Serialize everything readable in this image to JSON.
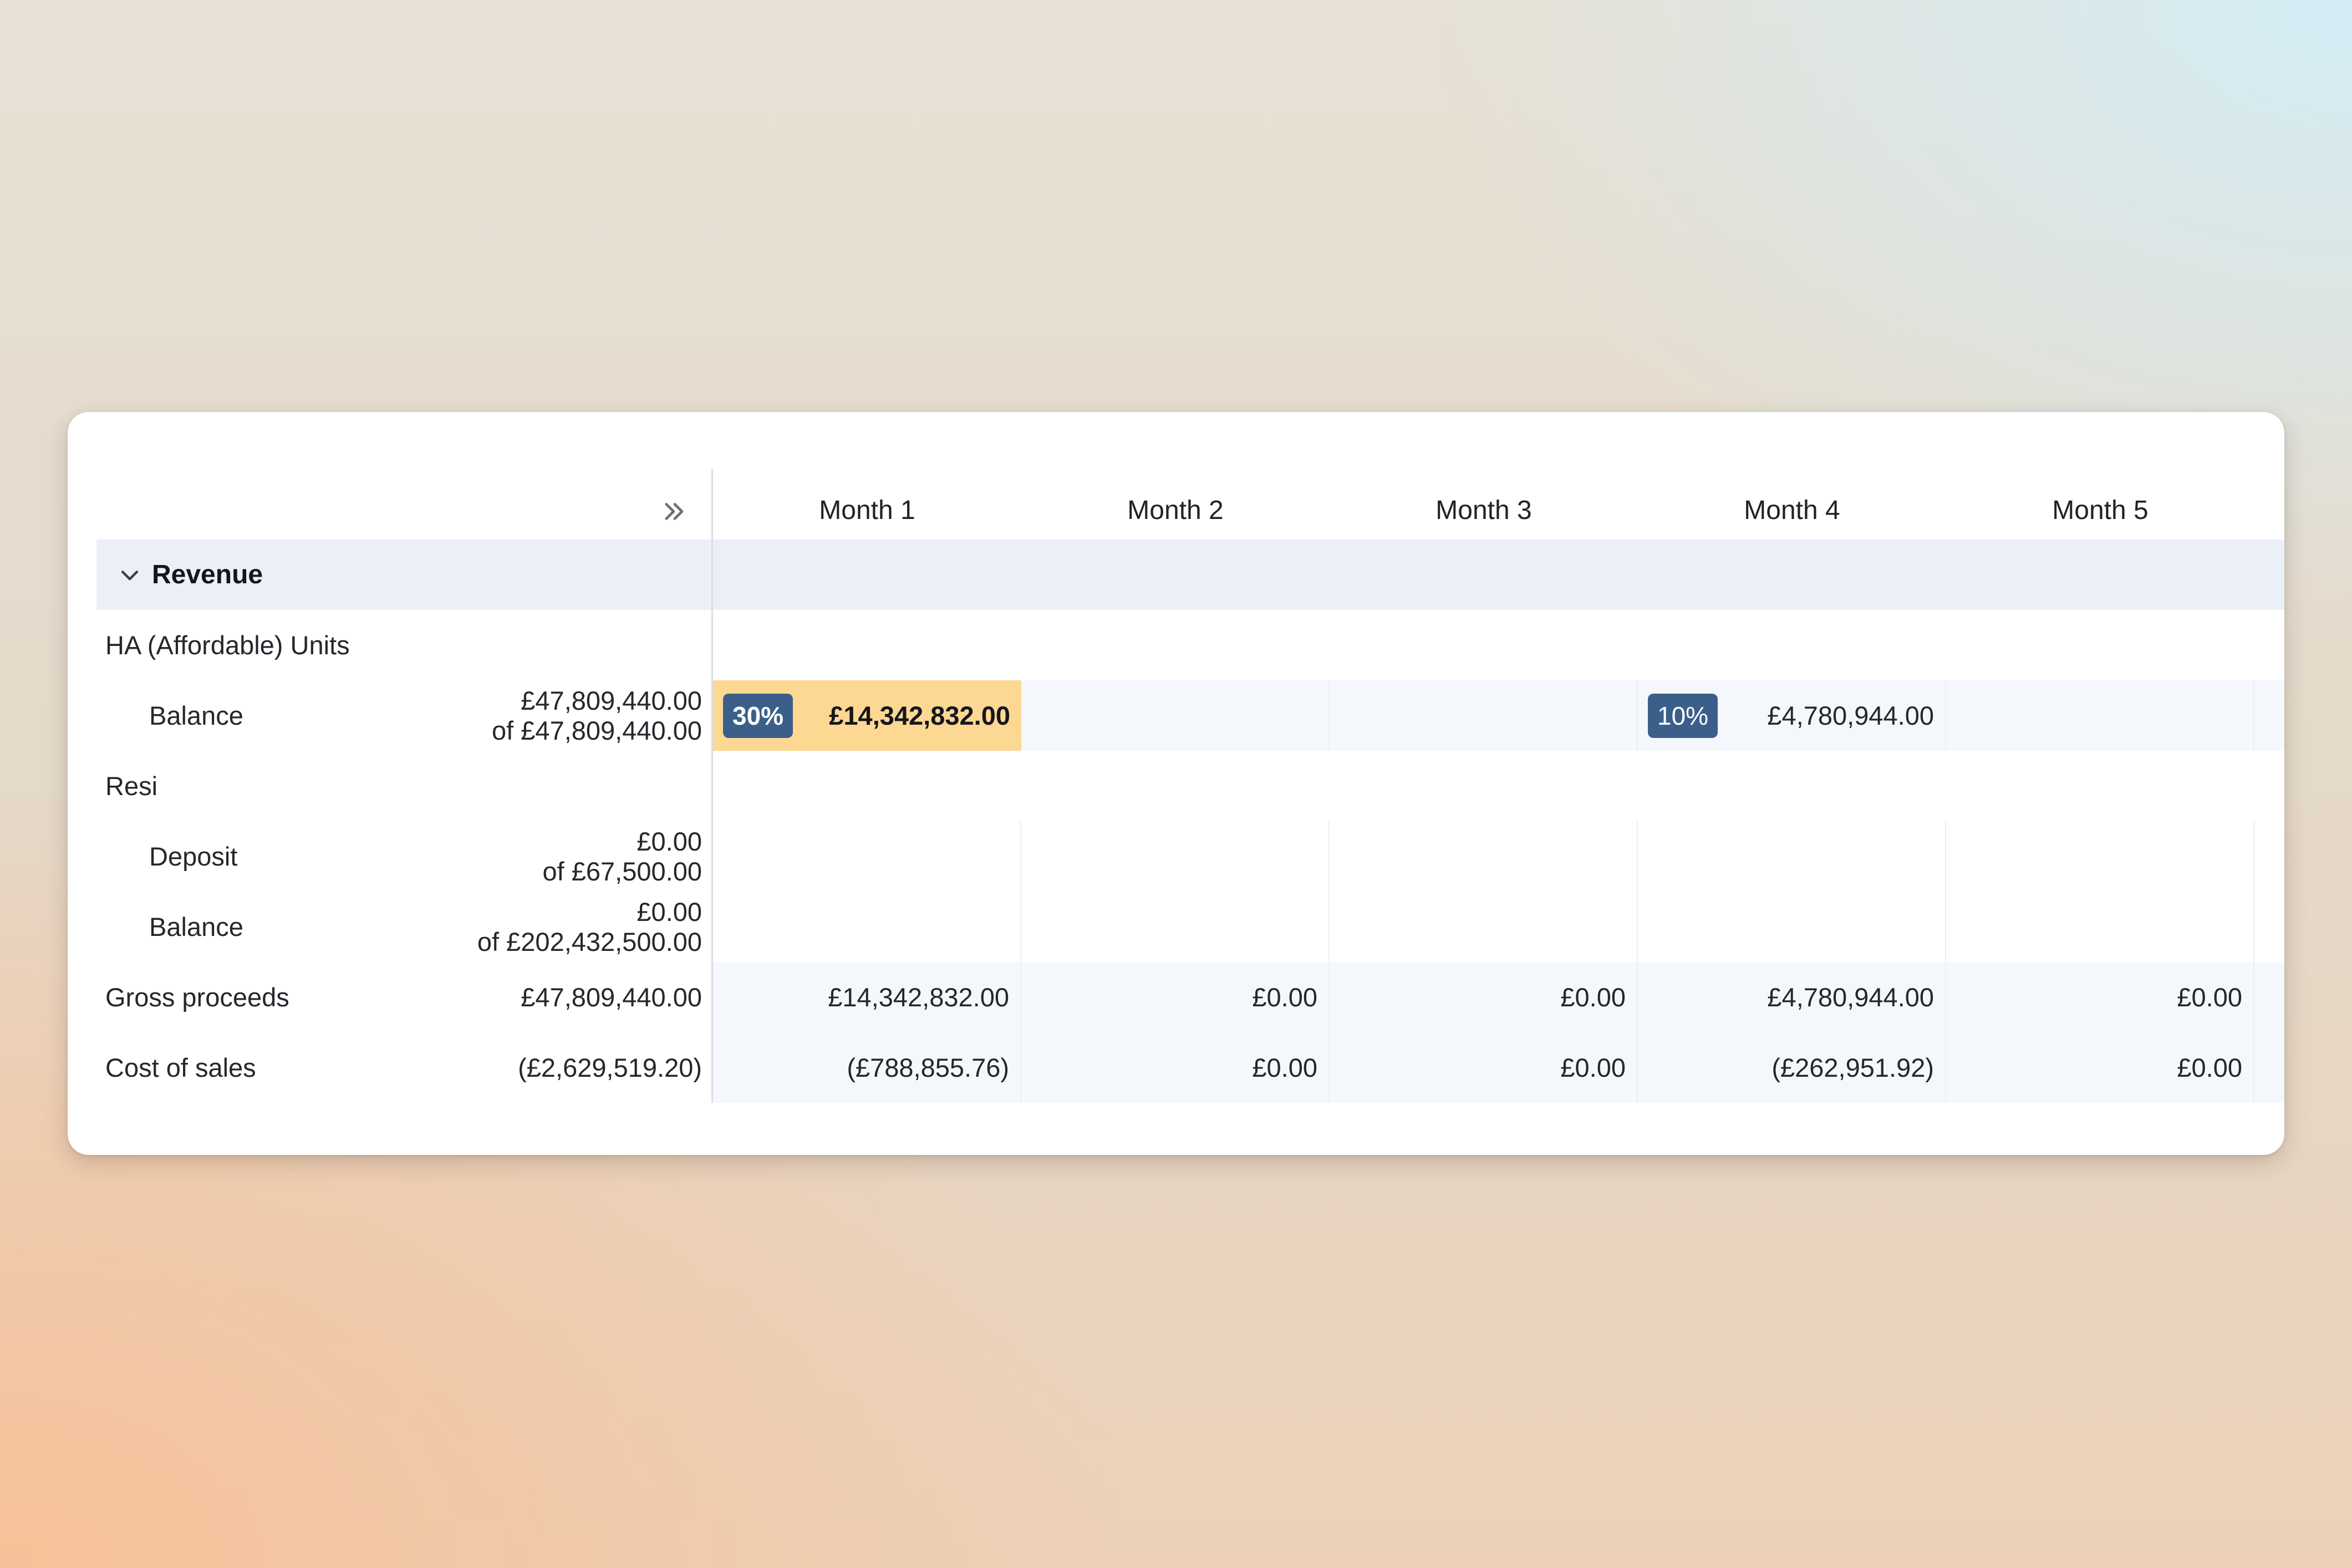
{
  "columns": [
    "Month 1",
    "Month 2",
    "Month 3",
    "Month 4",
    "Month 5"
  ],
  "icons": {
    "expand": "double-chevron-right-icon",
    "collapse": "chevron-down-icon"
  },
  "colors": {
    "section_bg": "#ebeff7",
    "highlight": "#fcd893",
    "pct_badge": "#3c5f8a",
    "row_tint": "#f4f8fc"
  },
  "section": {
    "title": "Revenue"
  },
  "ha_group": {
    "label": "HA (Affordable) Units",
    "balance": {
      "label": "Balance",
      "allocated": "£47,809,440.00",
      "of_total": "of £47,809,440.00",
      "month1": {
        "pct": "30%",
        "value": "£14,342,832.00"
      },
      "month4": {
        "pct": "10%",
        "value": "£4,780,944.00"
      }
    }
  },
  "resi_group": {
    "label": "Resi",
    "deposit": {
      "label": "Deposit",
      "allocated": "£0.00",
      "of_total": "of £67,500.00"
    },
    "balance": {
      "label": "Balance",
      "allocated": "£0.00",
      "of_total": "of £202,432,500.00"
    }
  },
  "gross_proceeds": {
    "label": "Gross proceeds",
    "total": "£47,809,440.00",
    "months": [
      "£14,342,832.00",
      "£0.00",
      "£0.00",
      "£4,780,944.00",
      "£0.00"
    ]
  },
  "cost_of_sales": {
    "label": "Cost of sales",
    "total": "(£2,629,519.20)",
    "months": [
      "(£788,855.76)",
      "£0.00",
      "£0.00",
      "(£262,951.92)",
      "£0.00"
    ]
  }
}
